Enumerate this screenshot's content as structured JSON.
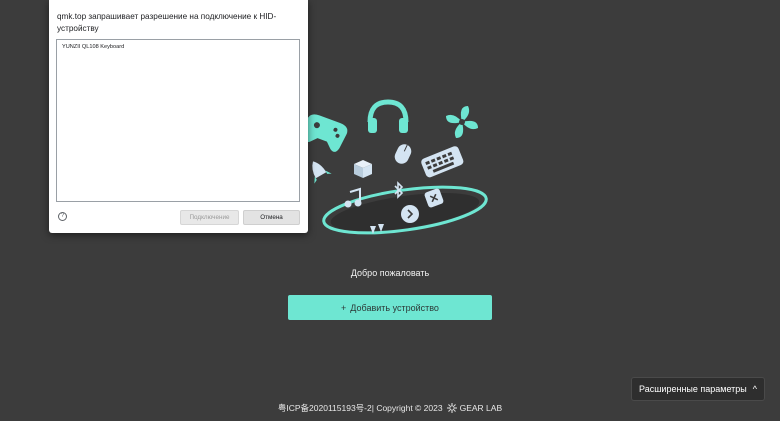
{
  "dialog": {
    "title": "qmk.top запрашивает разрешение на подключение к HID-устройству",
    "devices": [
      "YUNZII QL108 Keyboard"
    ],
    "help_symbol": "?",
    "connect_label": "Подключение",
    "cancel_label": "Отмена"
  },
  "main": {
    "welcome": "Добро пожаловать",
    "add_device_plus": "+",
    "add_device_label": "Добавить устройство"
  },
  "advanced": {
    "label": "Расширенные параметры",
    "chevron": "^"
  },
  "footer": {
    "icp": "粤ICP备2020115193号-2",
    "copyright": " | Copyright © 2023 ",
    "brand": "GEAR LAB"
  },
  "colors": {
    "background": "#3c3c3c",
    "accent": "#6ee6d2",
    "illustration_light": "#d4e4f2"
  }
}
